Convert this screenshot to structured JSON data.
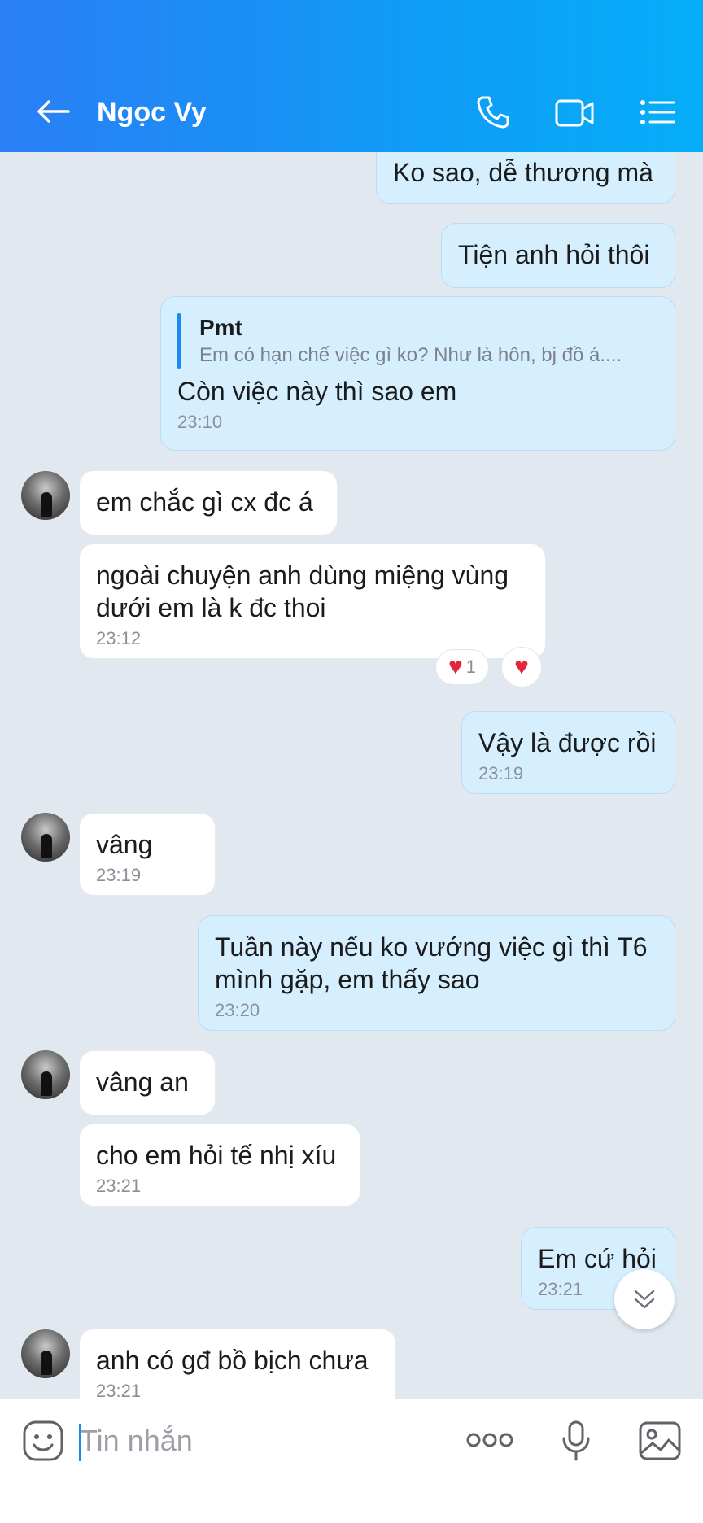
{
  "header": {
    "title": "Ngọc Vy",
    "icons": [
      "back-arrow-icon",
      "phone-icon",
      "video-call-icon",
      "menu-list-icon"
    ]
  },
  "messages": [
    {
      "from": "me",
      "text": "Ko sao, dễ thương mà"
    },
    {
      "from": "me",
      "text": "Tiện anh hỏi thôi"
    },
    {
      "from": "me",
      "quote_name": "Pmt",
      "quote_text": "Em có hạn chế việc gì ko? Như là hôn, bj đồ á....",
      "text": "Còn việc này thì sao em",
      "time": "23:10"
    },
    {
      "from": "them",
      "text": "em chắc gì cx đc á"
    },
    {
      "from": "them",
      "text": "ngoài chuyện anh dùng miệng vùng dưới em là k đc thoi",
      "time": "23:12",
      "reaction_count": "1"
    },
    {
      "from": "me",
      "text": "Vậy là được rồi",
      "time": "23:19"
    },
    {
      "from": "them",
      "text": "vâng",
      "time": "23:19"
    },
    {
      "from": "me",
      "text": "Tuần này nếu ko vướng việc gì thì T6 mình gặp, em thấy sao",
      "time": "23:20"
    },
    {
      "from": "them",
      "text": "vâng an"
    },
    {
      "from": "them",
      "text": "cho em hỏi tế nhị xíu",
      "time": "23:21"
    },
    {
      "from": "me",
      "text": "Em cứ hỏi",
      "time": "23:21"
    },
    {
      "from": "them",
      "text": "anh có gđ bồ bịch chưa",
      "time": "23:21"
    }
  ],
  "input": {
    "placeholder": "Tin nhắn",
    "icons": [
      "emoji-icon",
      "more-options-icon",
      "microphone-icon",
      "image-icon"
    ]
  },
  "colors": {
    "header_start": "#2a7ef6",
    "header_end": "#05aef8",
    "my_bubble": "#d5efff",
    "their_bubble": "#ffffff",
    "background": "#e2e8f0"
  }
}
